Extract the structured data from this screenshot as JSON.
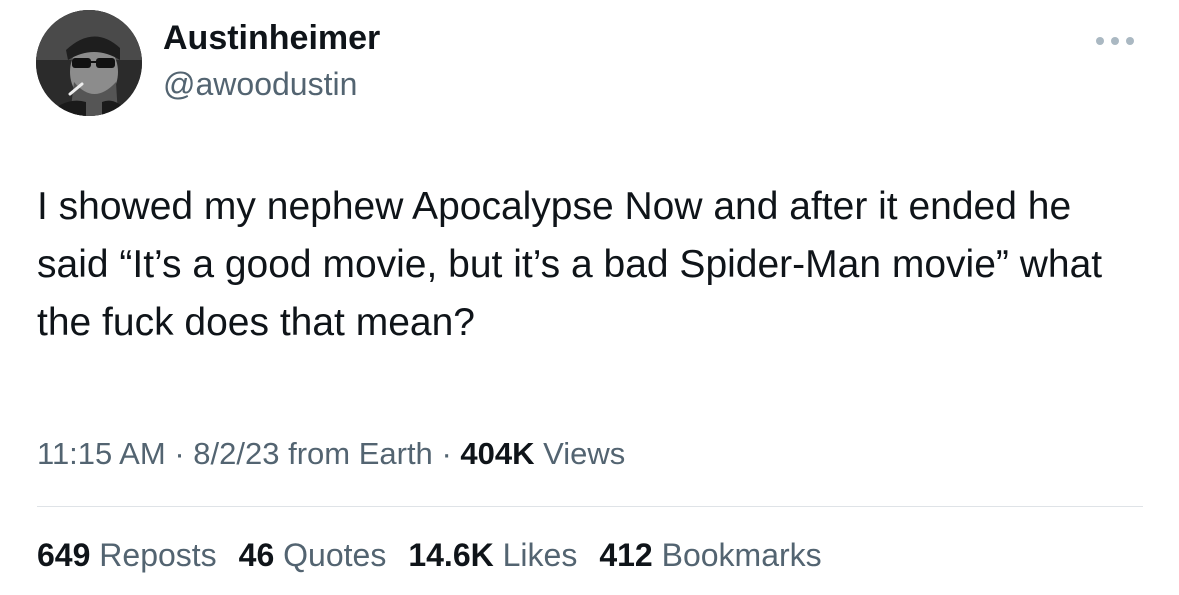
{
  "author": {
    "display_name": "Austinheimer",
    "handle": "@awoodustin"
  },
  "tweet": {
    "text": "I showed my nephew Apocalypse Now and after it ended he said “It’s a good movie, but it’s a bad Spider-Man movie” what the fuck does that mean?"
  },
  "meta": {
    "time": "11:15 AM",
    "date": "8/2/23",
    "source": "from Earth",
    "views_count": "404K",
    "views_label": "Views",
    "separator": "·"
  },
  "stats": {
    "reposts_count": "649",
    "reposts_label": "Reposts",
    "quotes_count": "46",
    "quotes_label": "Quotes",
    "likes_count": "14.6K",
    "likes_label": "Likes",
    "bookmarks_count": "412",
    "bookmarks_label": "Bookmarks"
  },
  "icons": {
    "more": "more-horizontal-icon"
  },
  "colors": {
    "text_primary": "#0f1419",
    "text_secondary": "#536471",
    "divider": "#dfe3e7"
  }
}
